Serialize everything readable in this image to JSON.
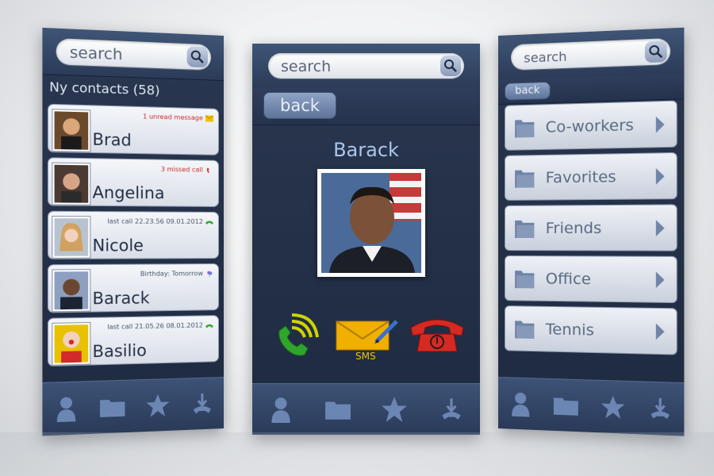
{
  "left_screen": {
    "search_placeholder": "search",
    "list_title": "Ny contacts (58)",
    "contacts": [
      {
        "name": "Brad",
        "status": "1 unread message",
        "status_color": "#d22a2a",
        "status_icon": "envelope-icon"
      },
      {
        "name": "Angelina",
        "status": "3 missed call",
        "status_color": "#d22a2a",
        "status_icon": "missed-call-icon"
      },
      {
        "name": "Nicole",
        "status": "last call 22.23.56   09.01.2012",
        "status_color": "#4a5568",
        "status_icon": "phone-icon"
      },
      {
        "name": "Barack",
        "status": "Birthday: Tomorrow",
        "status_color": "#4a5568",
        "status_icon": "balloon-icon"
      },
      {
        "name": "Basilio",
        "status": "last call 21.05.26   08.01.2012",
        "status_color": "#4a5568",
        "status_icon": "phone-icon"
      }
    ]
  },
  "center_screen": {
    "search_placeholder": "search",
    "back_label": "back",
    "contact_name": "Barack",
    "sms_label": "SMS"
  },
  "right_screen": {
    "search_placeholder": "search",
    "back_label": "back",
    "folders": [
      "Co-workers",
      "Favorites",
      "Friends",
      "Office",
      "Tennis"
    ]
  },
  "tabs": [
    "person-icon",
    "folder-icon",
    "star-icon",
    "call-log-icon"
  ],
  "colors": {
    "panel": "#1e2a40",
    "accent_blue": "#aac6ec",
    "call_green": "#2fa52c",
    "end_red": "#d32a22",
    "sms_yellow": "#f0c300"
  }
}
